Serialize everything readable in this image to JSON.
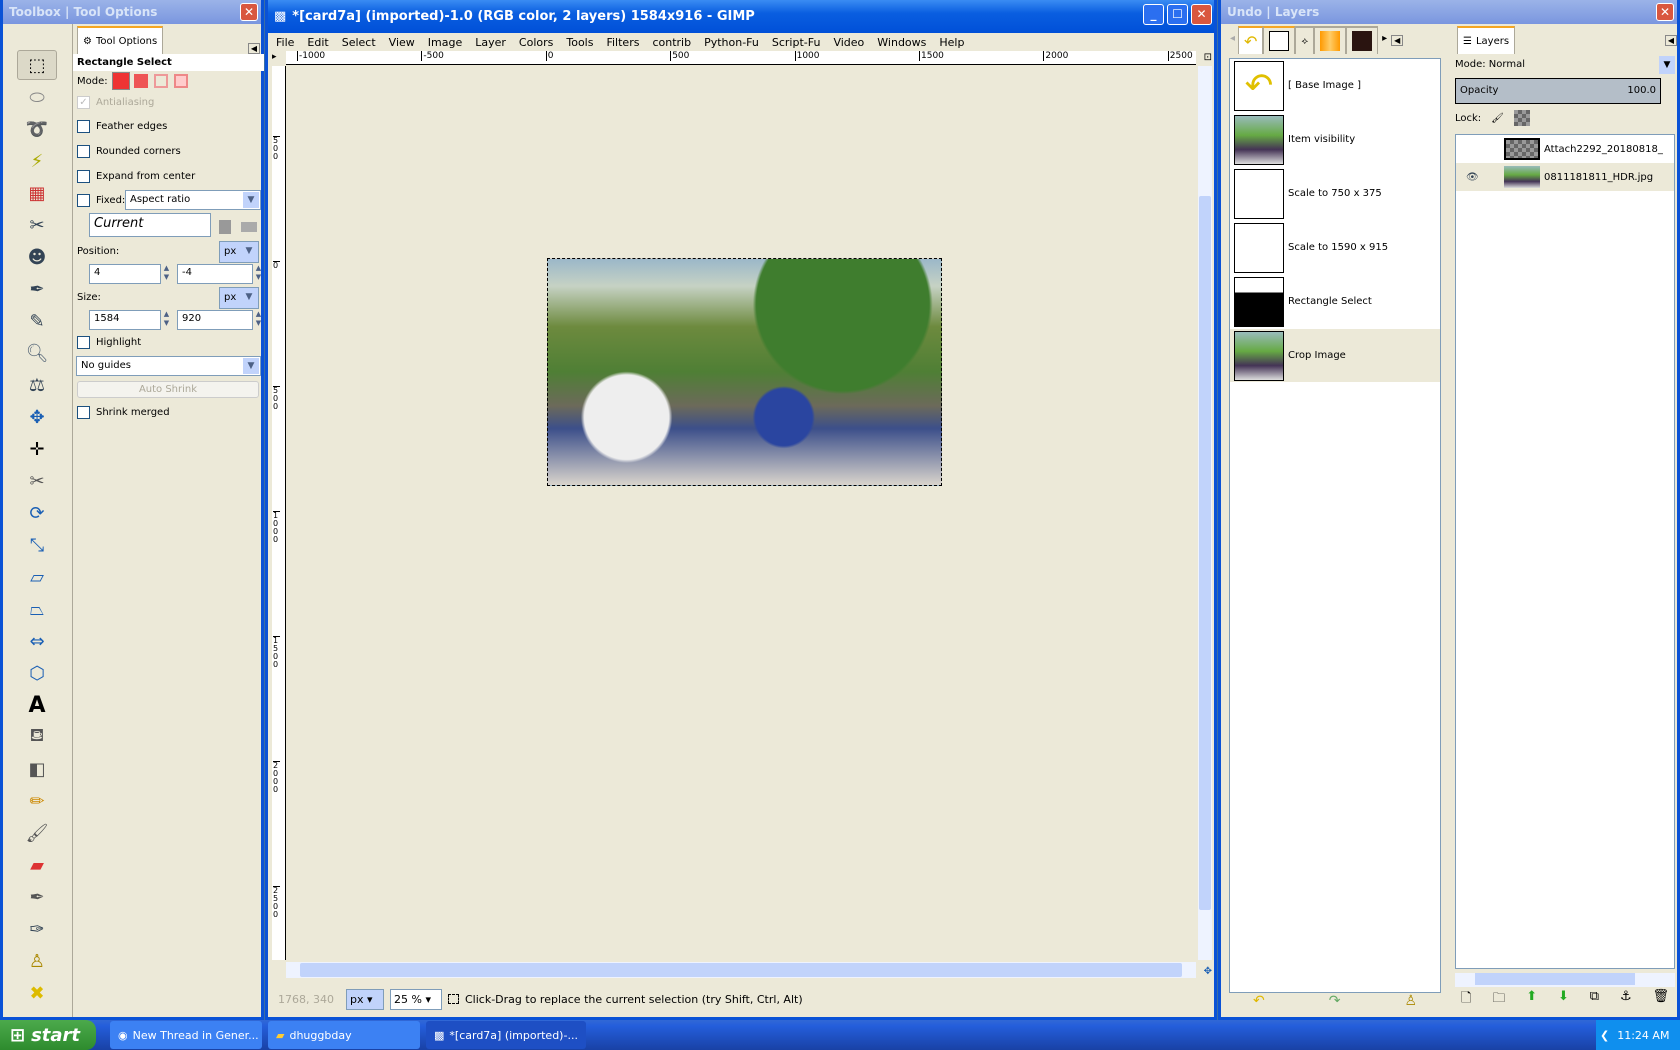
{
  "toolbox": {
    "title": "Toolbox | Tool Options",
    "tab": "Tool Options",
    "tool_name": "Rectangle Select",
    "mode_label": "Mode:",
    "antialiasing": "Antialiasing",
    "feather": "Feather edges",
    "rounded": "Rounded corners",
    "expand": "Expand from center",
    "fixed": "Fixed:",
    "fixed_value": "Aspect ratio",
    "current": "Current",
    "position_label": "Position:",
    "pos_unit": "px",
    "pos_x": "4",
    "pos_y": "-4",
    "size_label": "Size:",
    "size_unit": "px",
    "size_w": "1584",
    "size_h": "920",
    "highlight": "Highlight",
    "guides": "No guides",
    "auto_shrink": "Auto Shrink",
    "shrink_merged": "Shrink merged"
  },
  "image_window": {
    "title": "*[card7a] (imported)-1.0 (RGB color, 2 layers) 1584x916 - GIMP",
    "menu": [
      "File",
      "Edit",
      "Select",
      "View",
      "Image",
      "Layer",
      "Colors",
      "Tools",
      "Filters",
      "contrib",
      "Python-Fu",
      "Script-Fu",
      "Video",
      "Windows",
      "Help"
    ],
    "ruler_h": [
      "-1000",
      "-500",
      "0",
      "500",
      "1000",
      "1500",
      "2000",
      "2500"
    ],
    "ruler_v": [
      "500",
      "0",
      "500",
      "1000",
      "1500",
      "2000",
      "2500"
    ],
    "coords": "1768, 340",
    "unit": "px",
    "zoom": "25 %",
    "status": "Click-Drag to replace the current selection (try Shift, Ctrl, Alt)"
  },
  "undo_layers": {
    "title": "Undo | Layers",
    "history": [
      "[ Base Image ]",
      "Item visibility",
      "Scale to 750 x 375",
      "Scale to 1590 x 915",
      "Rectangle Select",
      "Crop Image"
    ],
    "layers_tab": "Layers",
    "mode": "Mode: Normal",
    "opacity_label": "Opacity",
    "opacity_value": "100.0",
    "lock_label": "Lock:",
    "layers": [
      {
        "name": "Attach2292_20180818_",
        "visible": false
      },
      {
        "name": "0811181811_HDR.jpg",
        "visible": true
      }
    ]
  },
  "taskbar": {
    "start": "start",
    "items": [
      "New Thread in Gener...",
      "dhuggbday",
      "*[card7a] (imported)-..."
    ],
    "clock": "11:24 AM"
  }
}
